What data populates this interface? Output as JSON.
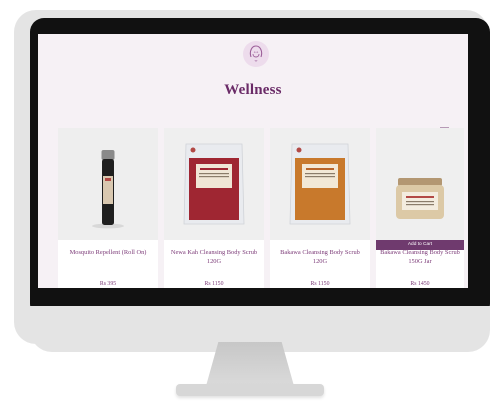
{
  "page": {
    "title": "Wellness"
  },
  "products": [
    {
      "name": "Mosquito Repellent (Roll On)",
      "price": "Rs 395"
    },
    {
      "name": "Newa Kah Cleansing Body Scrub 120G",
      "price": "Rs 1150"
    },
    {
      "name": "Bakawa Cleansing Body Scrub 120G",
      "price": "Rs 1150"
    },
    {
      "name": "Bakawa Cleansing Body Scrub 150G Jar",
      "price": "Rs 1450",
      "hover_button": "Add to Cart"
    }
  ],
  "colors": {
    "accent": "#6f3a6e",
    "text_purple": "#7c3b78",
    "screen_bg": "#f6f1f5",
    "bezel": "#111111",
    "monitor_body": "#e4e4e4"
  },
  "icons": {
    "logo": "woman-face-logo-icon",
    "wishlist": "wishlist-icon"
  }
}
